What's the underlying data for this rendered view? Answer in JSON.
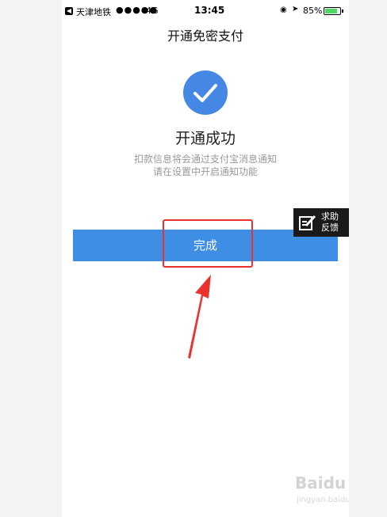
{
  "status_bar": {
    "carrier": "天津地铁",
    "signal_dots": "●●●●●",
    "network": "4G",
    "time": "13:45",
    "battery": "85%",
    "battery_level": 0.85
  },
  "page": {
    "title": "开通免密支付",
    "success_title": "开通成功",
    "desc_line1": "扣款信息将会通过支付宝消息通知",
    "desc_line2": "请在设置中开启通知功能",
    "done_label": "完成"
  },
  "feedback": {
    "line1": "求助",
    "line2": "反馈"
  },
  "annotation": {
    "highlight_color": "#e8322b",
    "accent_color": "#4587e4"
  },
  "watermark": {
    "brand": "Baidu",
    "sub": "jingyan.baidu.com"
  }
}
